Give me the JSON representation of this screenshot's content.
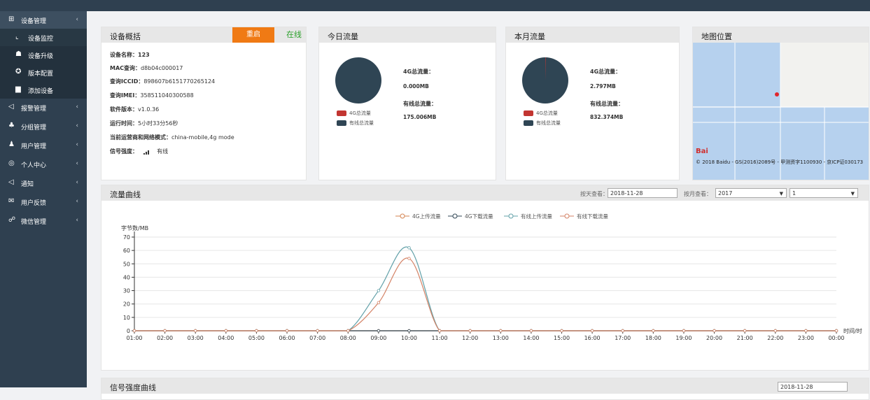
{
  "sidebar": {
    "items": [
      {
        "label": "设备管理",
        "icon": "grid-icon",
        "chevron": "‹"
      },
      {
        "label": "设备监控",
        "icon": "chart-line-icon"
      },
      {
        "label": "设备升级",
        "icon": "upload-icon"
      },
      {
        "label": "版本配置",
        "icon": "version-icon"
      },
      {
        "label": "添加设备",
        "icon": "add-device-icon"
      },
      {
        "label": "报警管理",
        "icon": "megaphone-icon",
        "chevron": "‹"
      },
      {
        "label": "分组管理",
        "icon": "group-icon",
        "chevron": "‹"
      },
      {
        "label": "用户管理",
        "icon": "user-icon",
        "chevron": "‹"
      },
      {
        "label": "个人中心",
        "icon": "person-circle-icon",
        "chevron": "‹"
      },
      {
        "label": "通知",
        "icon": "speaker-icon",
        "chevron": "‹"
      },
      {
        "label": "用户反馈",
        "icon": "mail-icon",
        "chevron": "‹"
      },
      {
        "label": "微信管理",
        "icon": "wechat-icon",
        "chevron": "‹"
      }
    ]
  },
  "overview": {
    "title": "设备概括",
    "restart_label": "重启",
    "status": "在线",
    "rows": [
      {
        "k": "设备名称：",
        "v": "123"
      },
      {
        "k": "MAC查询：",
        "v": "d8b04c000017"
      },
      {
        "k": "查询ICCID：",
        "v": "898607b6151770265124"
      },
      {
        "k": "查询IMEI：",
        "v": "358511040300588"
      },
      {
        "k": "软件版本：",
        "v": "v1.0.36"
      },
      {
        "k": "运行时间：",
        "v": "5小时33分56秒"
      },
      {
        "k": "当前运营商和网络模式：",
        "v": "china-mobile,4g mode"
      },
      {
        "k": "信号强度：",
        "v": "有线"
      }
    ]
  },
  "today": {
    "title": "今日流量",
    "legend_4g": "4G总流量",
    "legend_wired": "有线总流量",
    "label_4g": "4G总流量：",
    "value_4g": "0.000MB",
    "label_wired": "有线总流量：",
    "value_wired": "175.006MB",
    "fraction_4g": 0.0
  },
  "month": {
    "title": "本月流量",
    "legend_4g": "4G总流量",
    "legend_wired": "有线总流量",
    "label_4g": "4G总流量：",
    "value_4g": "2.797MB",
    "label_wired": "有线总流量：",
    "value_wired": "832.374MB",
    "fraction_4g": 0.0033
  },
  "map": {
    "title": "地图位置",
    "logo_text": "Bai",
    "copyright": "© 2018 Baidu - GS(2016)2089号 - 甲测资字1100930 - 京ICP证030173"
  },
  "traffic": {
    "title": "流量曲线",
    "day_label": "按天查看：",
    "day_value": "2018-11-28",
    "month_label": "按月查看：",
    "year_value": "2017",
    "month_value": "1",
    "ylabel": "字节数/MB",
    "xlabel": "时间/时",
    "legend": [
      "4G上传流量",
      "4G下载流量",
      "有线上传流量",
      "有线下载流量"
    ]
  },
  "signal": {
    "title": "信号强度曲线",
    "date_value": "2018-11-28"
  },
  "colors": {
    "sidebar": "#2f4050",
    "orange": "#f07a14",
    "green": "#2aa02a",
    "pie_dark": "#2f4554",
    "pie_red": "#c23531",
    "line_4g_up": "#d4834f",
    "line_4g_down": "#2f4554",
    "line_wired_up": "#61a0a8",
    "line_wired_down": "#d48265"
  },
  "chart_data": {
    "type": "line",
    "title": "",
    "xlabel": "时间/时",
    "ylabel": "字节数/MB",
    "ylim": [
      0,
      70
    ],
    "yticks": [
      0,
      10,
      20,
      30,
      40,
      50,
      60,
      70
    ],
    "categories": [
      "01:00",
      "02:00",
      "03:00",
      "04:00",
      "05:00",
      "06:00",
      "07:00",
      "08:00",
      "09:00",
      "10:00",
      "11:00",
      "12:00",
      "13:00",
      "14:00",
      "15:00",
      "16:00",
      "17:00",
      "18:00",
      "19:00",
      "20:00",
      "21:00",
      "22:00",
      "23:00",
      "00:00"
    ],
    "series": [
      {
        "name": "4G上传流量",
        "color": "#d4834f",
        "values": [
          0,
          0,
          0,
          0,
          0,
          0,
          0,
          0,
          0,
          0,
          0,
          0,
          0,
          0,
          0,
          0,
          0,
          0,
          0,
          0,
          0,
          0,
          0,
          0
        ]
      },
      {
        "name": "4G下载流量",
        "color": "#2f4554",
        "values": [
          0,
          0,
          0,
          0,
          0,
          0,
          0,
          0,
          0,
          0,
          0,
          0,
          0,
          0,
          0,
          0,
          0,
          0,
          0,
          0,
          0,
          0,
          0,
          0
        ]
      },
      {
        "name": "有线上传流量",
        "color": "#61a0a8",
        "values": [
          0,
          0,
          0,
          0,
          0,
          0,
          0,
          0,
          30,
          62,
          0,
          0,
          0,
          0,
          0,
          0,
          0,
          0,
          0,
          0,
          0,
          0,
          0,
          0
        ]
      },
      {
        "name": "有线下载流量",
        "color": "#d48265",
        "values": [
          0,
          0,
          0,
          0,
          0,
          0,
          0,
          0,
          21,
          54,
          0,
          0,
          0,
          0,
          0,
          0,
          0,
          0,
          0,
          0,
          0,
          0,
          0,
          0
        ]
      }
    ],
    "legend_position": "top-center",
    "grid": true
  }
}
